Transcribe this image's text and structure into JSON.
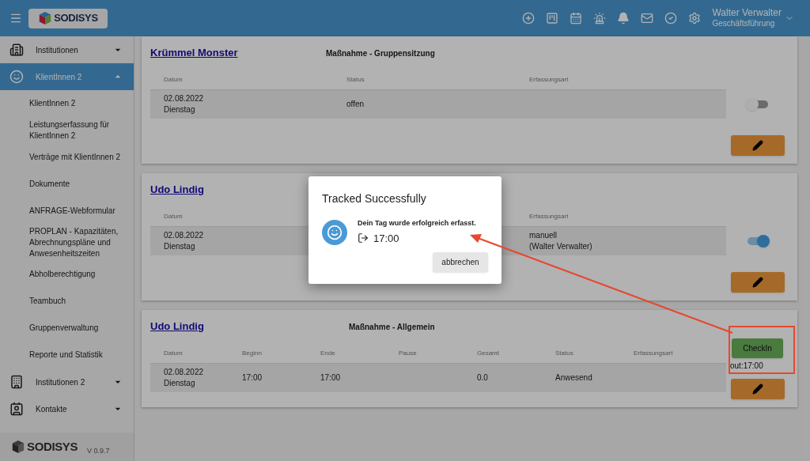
{
  "header": {
    "logo": "SODISYS",
    "user_name": "Walter Verwalter",
    "user_role": "Geschäftsführung"
  },
  "sidebar": {
    "items": [
      {
        "label": "Institutionen",
        "expanded": false,
        "selected": false
      },
      {
        "label": "KlientInnen 2",
        "expanded": true,
        "selected": true,
        "children": [
          {
            "label": "KlientInnen 2"
          },
          {
            "label": "Leistungserfassung für KlientInnen 2"
          },
          {
            "label": "Verträge mit KlientInnen 2"
          },
          {
            "label": "Dokumente"
          },
          {
            "label": "ANFRAGE-Webformular"
          },
          {
            "label": "PROPLAN - Kapazitäten, Abrechnungspläne und Anwesenheitszeiten"
          },
          {
            "label": "Abholberechtigung"
          },
          {
            "label": "Teambuch"
          },
          {
            "label": "Gruppenverwaltung"
          },
          {
            "label": "Reporte und Statistik"
          }
        ]
      },
      {
        "label": "Institutionen 2",
        "expanded": false,
        "selected": false
      },
      {
        "label": "Kontakte",
        "expanded": false,
        "selected": false
      }
    ],
    "footer_logo": "SODISYS",
    "version": "V 0.9.7"
  },
  "cards": [
    {
      "kind": "toggle",
      "name": "Krümmel Monster",
      "subtitle": "Maßnahme - Gruppensitzung",
      "on": false,
      "columns": [
        {
          "label": "Datum",
          "lines": [
            "02.08.2022",
            "Dienstag"
          ]
        },
        {
          "label": "Status",
          "lines": [
            "offen"
          ]
        },
        {
          "label": "Erfassungsart"
        }
      ]
    },
    {
      "kind": "toggle",
      "name": "Udo Lindig",
      "on": true,
      "columns": [
        {
          "label": "Datum",
          "lines": [
            "02.08.2022",
            "Dienstag"
          ]
        },
        {},
        {
          "label": "Erfassungsart",
          "lines": [
            "manuell",
            "(Walter Verwalter)"
          ]
        }
      ]
    },
    {
      "kind": "checkin",
      "name": "Udo Lindig",
      "subtitle": "Maßnahme - Allgemein",
      "button": "CheckIn",
      "checkout": "out:17:00",
      "columns": [
        {
          "label": "Datum",
          "lines": [
            "02.08.2022",
            "Dienstag"
          ]
        },
        {
          "label": "Beginn",
          "lines": [
            "17:00"
          ]
        },
        {
          "label": "Ende",
          "lines": [
            "17:00"
          ]
        },
        {
          "label": "Pause"
        },
        {
          "label": "Gesamt",
          "lines": [
            "0.0"
          ]
        },
        {
          "label": "Status",
          "lines": [
            "Anwesend"
          ]
        },
        {
          "label": "Erfassungsart"
        }
      ]
    }
  ],
  "dialog": {
    "title": "Tracked Successfully",
    "message": "Dein Tag wurde erfolgreich erfasst.",
    "time": "17:00",
    "button": "abbrechen"
  }
}
